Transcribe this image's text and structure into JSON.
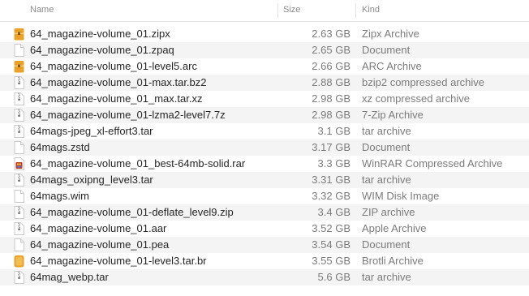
{
  "header": {
    "name_label": "Name",
    "size_label": "Size",
    "kind_label": "Kind"
  },
  "colors": {
    "stripe": "#f4f4f4",
    "archive_orange": "#e9a12a",
    "document_gray": "#c9c9c9",
    "winrar_red": "#c23b22"
  },
  "files": [
    {
      "name": "64_magazine-volume_01.zipx",
      "size": "2.63 GB",
      "kind": "Zipx Archive",
      "icon": "zipx-archive-icon"
    },
    {
      "name": "64_magazine-volume_01.zpaq",
      "size": "2.65 GB",
      "kind": "Document",
      "icon": "document-icon"
    },
    {
      "name": "64_magazine-volume_01-level5.arc",
      "size": "2.66 GB",
      "kind": "ARC Archive",
      "icon": "arc-archive-icon"
    },
    {
      "name": "64_magazine-volume_01-max.tar.bz2",
      "size": "2.88 GB",
      "kind": "bzip2 compressed archive",
      "icon": "zipper-archive-icon"
    },
    {
      "name": "64_magazine-volume_01_max.tar.xz",
      "size": "2.98 GB",
      "kind": "xz compressed archive",
      "icon": "zipper-archive-icon"
    },
    {
      "name": "64_magazine-volume_01-lzma2-level7.7z",
      "size": "2.98 GB",
      "kind": "7-Zip Archive",
      "icon": "zipper-archive-icon"
    },
    {
      "name": "64mags-jpeg_xl-effort3.tar",
      "size": "3.1 GB",
      "kind": "tar archive",
      "icon": "zipper-archive-icon"
    },
    {
      "name": "64mags.zstd",
      "size": "3.17 GB",
      "kind": "Document",
      "icon": "document-icon"
    },
    {
      "name": "64_magazine-volume_01_best-64mb-solid.rar",
      "size": "3.3 GB",
      "kind": "WinRAR Compressed Archive",
      "icon": "winrar-archive-icon"
    },
    {
      "name": "64mags_oxipng_level3.tar",
      "size": "3.31 GB",
      "kind": "tar archive",
      "icon": "zipper-archive-icon"
    },
    {
      "name": "64mags.wim",
      "size": "3.32 GB",
      "kind": "WIM Disk Image",
      "icon": "document-icon"
    },
    {
      "name": "64_magazine-volume_01-deflate_level9.zip",
      "size": "3.4 GB",
      "kind": "ZIP archive",
      "icon": "zipper-archive-icon"
    },
    {
      "name": "64_magazine-volume_01.aar",
      "size": "3.52 GB",
      "kind": "Apple Archive",
      "icon": "zipper-archive-icon"
    },
    {
      "name": "64_magazine-volume_01.pea",
      "size": "3.54 GB",
      "kind": "Document",
      "icon": "document-icon"
    },
    {
      "name": "64_magazine-volume_01-level3.tar.br",
      "size": "3.55 GB",
      "kind": "Brotli Archive",
      "icon": "brotli-archive-icon"
    },
    {
      "name": "64mag_webp.tar",
      "size": "5.6 GB",
      "kind": "tar archive",
      "icon": "zipper-archive-icon"
    }
  ]
}
